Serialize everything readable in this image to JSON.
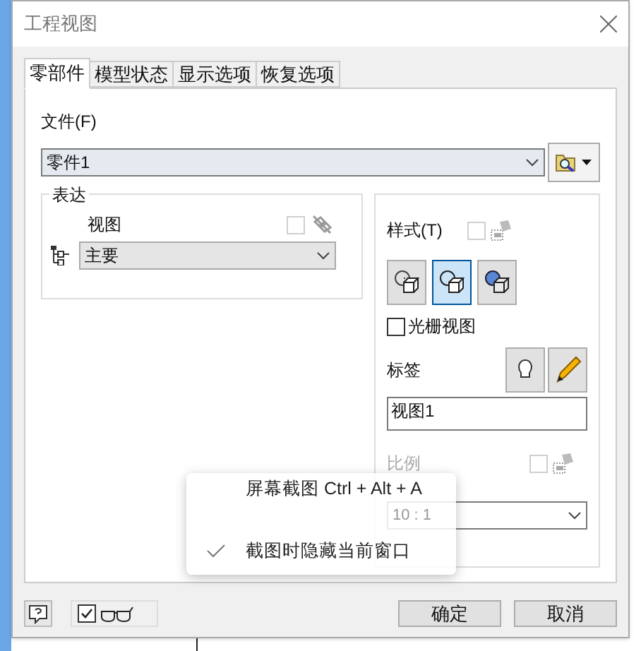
{
  "window": {
    "title": "工程视图"
  },
  "tabs": [
    {
      "label": "零部件",
      "selected": true
    },
    {
      "label": "模型状态",
      "selected": false
    },
    {
      "label": "显示选项",
      "selected": false
    },
    {
      "label": "恢复选项",
      "selected": false
    }
  ],
  "file": {
    "label": "文件(F)",
    "value": "零件1"
  },
  "representation": {
    "title": "表达",
    "view_label": "视图",
    "view_value": "主要",
    "checked": false
  },
  "style": {
    "label": "样式(T)",
    "checked": false,
    "modes": [
      {
        "kind": "hidden",
        "selected": false
      },
      {
        "kind": "visible",
        "selected": true
      },
      {
        "kind": "shaded",
        "selected": false
      }
    ],
    "raster": {
      "label": "光栅视图",
      "checked": false
    }
  },
  "view_label": {
    "label": "标签",
    "value": "视图1"
  },
  "scale": {
    "label": "比例",
    "value": "10 : 1",
    "checked": false
  },
  "context_menu": {
    "items": [
      {
        "label": "屏幕截图 Ctrl + Alt + A",
        "checked": false
      },
      {
        "label": "截图时隐藏当前窗口",
        "checked": true
      }
    ]
  },
  "footer": {
    "preview_checked": true,
    "buttons": [
      "确定",
      "取消"
    ]
  }
}
